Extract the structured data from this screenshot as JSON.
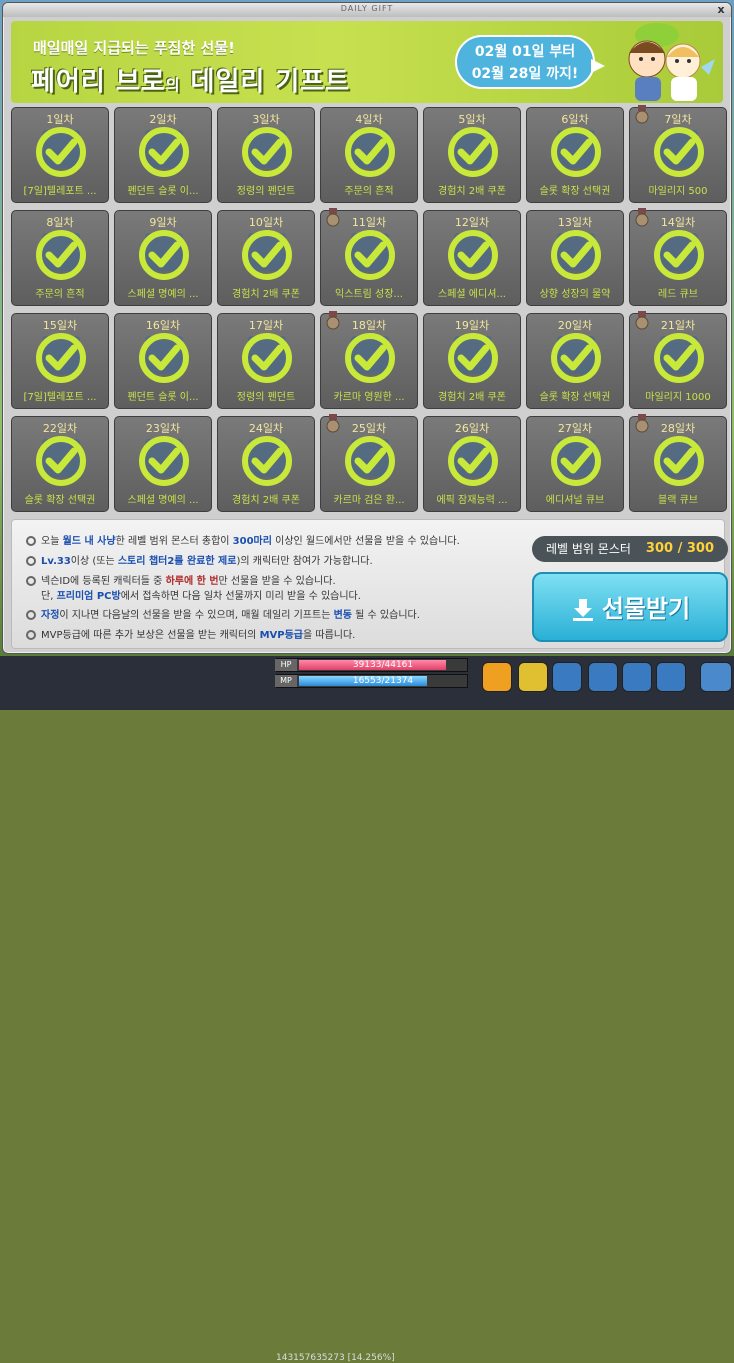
{
  "window": {
    "title": "DAILY GIFT",
    "close_label": "x"
  },
  "banner": {
    "subtitle": "매일매일 지급되는 푸짐한 선물!",
    "title_part1": "페어리 브로",
    "title_small": "의",
    "title_part2": " 데일리 기프트",
    "period_line1": "02월 01일 부터",
    "period_line2": "02월 28일 까지!"
  },
  "days": [
    {
      "day": "1일차",
      "name": "[7일]텔레포트 ..."
    },
    {
      "day": "2일차",
      "name": "펜던트 슬롯 이..."
    },
    {
      "day": "3일차",
      "name": "정령의 펜던트"
    },
    {
      "day": "4일차",
      "name": "주문의 흔적"
    },
    {
      "day": "5일차",
      "name": "경험치 2배 쿠폰"
    },
    {
      "day": "6일차",
      "name": "슬롯 확장 선택권"
    },
    {
      "day": "7일차",
      "name": "마일리지 500",
      "medal": true
    },
    {
      "day": "8일차",
      "name": "주문의 흔적"
    },
    {
      "day": "9일차",
      "name": "스페셜 명예의 ..."
    },
    {
      "day": "10일차",
      "name": "경험치 2배 쿠폰"
    },
    {
      "day": "11일차",
      "name": "익스트림 성장...",
      "medal": true
    },
    {
      "day": "12일차",
      "name": "스페셜 에디셔..."
    },
    {
      "day": "13일차",
      "name": "상향 성장의 물약"
    },
    {
      "day": "14일차",
      "name": "레드 큐브",
      "medal": true
    },
    {
      "day": "15일차",
      "name": "[7일]텔레포트 ..."
    },
    {
      "day": "16일차",
      "name": "펜던트 슬롯 이..."
    },
    {
      "day": "17일차",
      "name": "정령의 펜던트"
    },
    {
      "day": "18일차",
      "name": "카르마 영원한 ...",
      "medal": true
    },
    {
      "day": "19일차",
      "name": "경험치 2배 쿠폰"
    },
    {
      "day": "20일차",
      "name": "슬롯 확장 선택권"
    },
    {
      "day": "21일차",
      "name": "마일리지 1000",
      "medal": true
    },
    {
      "day": "22일차",
      "name": "슬롯 확장 선택권"
    },
    {
      "day": "23일차",
      "name": "스페셜 명예의 ..."
    },
    {
      "day": "24일차",
      "name": "경험치 2배 쿠폰"
    },
    {
      "day": "25일차",
      "name": "카르마 검은 환...",
      "medal": true
    },
    {
      "day": "26일차",
      "name": "에픽 잠재능력 ..."
    },
    {
      "day": "27일차",
      "name": "에디셔널 큐브"
    },
    {
      "day": "28일차",
      "name": "블랙 큐브",
      "medal": true
    }
  ],
  "rules": {
    "r1_pre": "오늘 ",
    "r1_hl": "월드 내 사냥",
    "r1_mid": "한 레벨 범위 몬스터 총합이 ",
    "r1_hl2": "300마리",
    "r1_post": " 이상인 월드에서만 선물을 받을 수 있습니다.",
    "r2_hl": "Lv.33",
    "r2_mid": "이상 (또는 ",
    "r2_hl2": "스토리 챕터2를 완료한 제로",
    "r2_post": ")의 캐릭터만 참여가 가능합니다.",
    "r3_pre": "넥슨ID에 등록된 캐릭터들 중 ",
    "r3_hl": "하루에 한 번",
    "r3_post": "만 선물을 받을 수 있습니다.",
    "r3b_pre": "단, ",
    "r3b_hl": "프리미엄 PC방",
    "r3b_post": "에서 접속하면 다음 일차 선물까지 미리 받을 수 있습니다.",
    "r4_hl": "자정",
    "r4_mid": "이 지나면 다음날의 선물을 받을 수 있으며, 매월 데일리 기프트는 ",
    "r4_hl2": "변동",
    "r4_post": " 될 수 있습니다.",
    "r5_pre": "MVP등급에 따른 추가 보상은 선물을 받는 캐릭터의 ",
    "r5_hl": "MVP등급",
    "r5_post": "을 따릅니다."
  },
  "monster": {
    "label": "레벨 범위 몬스터",
    "value": "300 / 300"
  },
  "receive_button": "선물받기",
  "hud": {
    "hp_label": "HP",
    "hp_text": "39133/44161",
    "hp_ratio": 0.886,
    "mp_label": "MP",
    "mp_text": "16553/21374",
    "mp_ratio": 0.774,
    "exp_text": "143157635273 [14.256%]"
  },
  "colors": {
    "check": "#c8e83a",
    "banner": "#b7d542",
    "button": "#2ab0d6"
  }
}
